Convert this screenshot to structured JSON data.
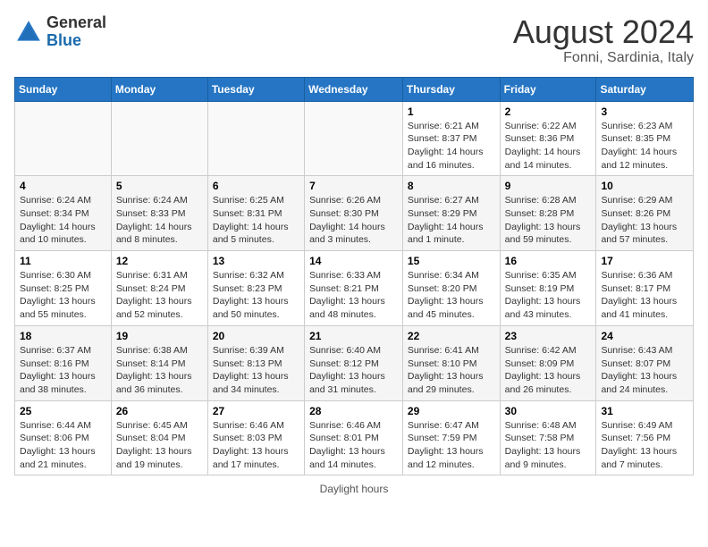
{
  "header": {
    "logo_line1": "General",
    "logo_line2": "Blue",
    "month_year": "August 2024",
    "location": "Fonni, Sardinia, Italy"
  },
  "weekdays": [
    "Sunday",
    "Monday",
    "Tuesday",
    "Wednesday",
    "Thursday",
    "Friday",
    "Saturday"
  ],
  "weeks": [
    [
      {
        "day": "",
        "info": ""
      },
      {
        "day": "",
        "info": ""
      },
      {
        "day": "",
        "info": ""
      },
      {
        "day": "",
        "info": ""
      },
      {
        "day": "1",
        "info": "Sunrise: 6:21 AM\nSunset: 8:37 PM\nDaylight: 14 hours and 16 minutes."
      },
      {
        "day": "2",
        "info": "Sunrise: 6:22 AM\nSunset: 8:36 PM\nDaylight: 14 hours and 14 minutes."
      },
      {
        "day": "3",
        "info": "Sunrise: 6:23 AM\nSunset: 8:35 PM\nDaylight: 14 hours and 12 minutes."
      }
    ],
    [
      {
        "day": "4",
        "info": "Sunrise: 6:24 AM\nSunset: 8:34 PM\nDaylight: 14 hours and 10 minutes."
      },
      {
        "day": "5",
        "info": "Sunrise: 6:24 AM\nSunset: 8:33 PM\nDaylight: 14 hours and 8 minutes."
      },
      {
        "day": "6",
        "info": "Sunrise: 6:25 AM\nSunset: 8:31 PM\nDaylight: 14 hours and 5 minutes."
      },
      {
        "day": "7",
        "info": "Sunrise: 6:26 AM\nSunset: 8:30 PM\nDaylight: 14 hours and 3 minutes."
      },
      {
        "day": "8",
        "info": "Sunrise: 6:27 AM\nSunset: 8:29 PM\nDaylight: 14 hours and 1 minute."
      },
      {
        "day": "9",
        "info": "Sunrise: 6:28 AM\nSunset: 8:28 PM\nDaylight: 13 hours and 59 minutes."
      },
      {
        "day": "10",
        "info": "Sunrise: 6:29 AM\nSunset: 8:26 PM\nDaylight: 13 hours and 57 minutes."
      }
    ],
    [
      {
        "day": "11",
        "info": "Sunrise: 6:30 AM\nSunset: 8:25 PM\nDaylight: 13 hours and 55 minutes."
      },
      {
        "day": "12",
        "info": "Sunrise: 6:31 AM\nSunset: 8:24 PM\nDaylight: 13 hours and 52 minutes."
      },
      {
        "day": "13",
        "info": "Sunrise: 6:32 AM\nSunset: 8:23 PM\nDaylight: 13 hours and 50 minutes."
      },
      {
        "day": "14",
        "info": "Sunrise: 6:33 AM\nSunset: 8:21 PM\nDaylight: 13 hours and 48 minutes."
      },
      {
        "day": "15",
        "info": "Sunrise: 6:34 AM\nSunset: 8:20 PM\nDaylight: 13 hours and 45 minutes."
      },
      {
        "day": "16",
        "info": "Sunrise: 6:35 AM\nSunset: 8:19 PM\nDaylight: 13 hours and 43 minutes."
      },
      {
        "day": "17",
        "info": "Sunrise: 6:36 AM\nSunset: 8:17 PM\nDaylight: 13 hours and 41 minutes."
      }
    ],
    [
      {
        "day": "18",
        "info": "Sunrise: 6:37 AM\nSunset: 8:16 PM\nDaylight: 13 hours and 38 minutes."
      },
      {
        "day": "19",
        "info": "Sunrise: 6:38 AM\nSunset: 8:14 PM\nDaylight: 13 hours and 36 minutes."
      },
      {
        "day": "20",
        "info": "Sunrise: 6:39 AM\nSunset: 8:13 PM\nDaylight: 13 hours and 34 minutes."
      },
      {
        "day": "21",
        "info": "Sunrise: 6:40 AM\nSunset: 8:12 PM\nDaylight: 13 hours and 31 minutes."
      },
      {
        "day": "22",
        "info": "Sunrise: 6:41 AM\nSunset: 8:10 PM\nDaylight: 13 hours and 29 minutes."
      },
      {
        "day": "23",
        "info": "Sunrise: 6:42 AM\nSunset: 8:09 PM\nDaylight: 13 hours and 26 minutes."
      },
      {
        "day": "24",
        "info": "Sunrise: 6:43 AM\nSunset: 8:07 PM\nDaylight: 13 hours and 24 minutes."
      }
    ],
    [
      {
        "day": "25",
        "info": "Sunrise: 6:44 AM\nSunset: 8:06 PM\nDaylight: 13 hours and 21 minutes."
      },
      {
        "day": "26",
        "info": "Sunrise: 6:45 AM\nSunset: 8:04 PM\nDaylight: 13 hours and 19 minutes."
      },
      {
        "day": "27",
        "info": "Sunrise: 6:46 AM\nSunset: 8:03 PM\nDaylight: 13 hours and 17 minutes."
      },
      {
        "day": "28",
        "info": "Sunrise: 6:46 AM\nSunset: 8:01 PM\nDaylight: 13 hours and 14 minutes."
      },
      {
        "day": "29",
        "info": "Sunrise: 6:47 AM\nSunset: 7:59 PM\nDaylight: 13 hours and 12 minutes."
      },
      {
        "day": "30",
        "info": "Sunrise: 6:48 AM\nSunset: 7:58 PM\nDaylight: 13 hours and 9 minutes."
      },
      {
        "day": "31",
        "info": "Sunrise: 6:49 AM\nSunset: 7:56 PM\nDaylight: 13 hours and 7 minutes."
      }
    ]
  ],
  "footer": {
    "daylight_note": "Daylight hours"
  }
}
